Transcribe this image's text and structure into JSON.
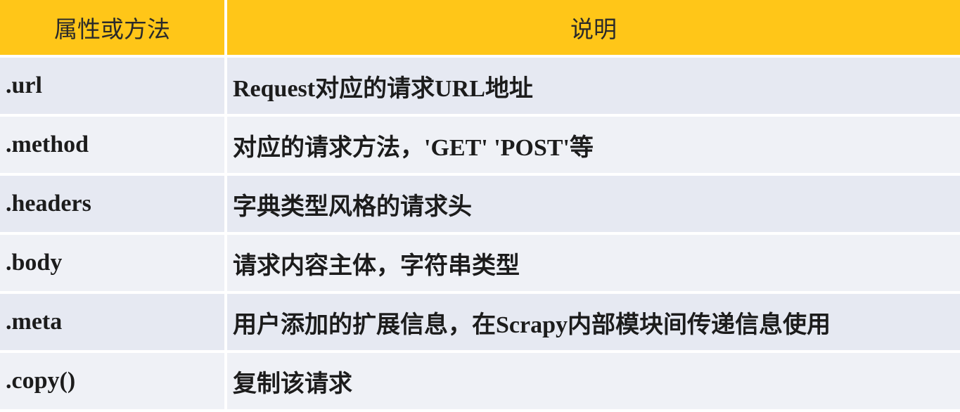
{
  "header": {
    "col1": "属性或方法",
    "col2": "说明"
  },
  "rows": [
    {
      "name": ".url",
      "desc": "Request对应的请求URL地址"
    },
    {
      "name": ".method",
      "desc": "对应的请求方法，'GET' 'POST'等"
    },
    {
      "name": ".headers",
      "desc": "字典类型风格的请求头"
    },
    {
      "name": ".body",
      "desc": "请求内容主体，字符串类型"
    },
    {
      "name": ".meta",
      "desc": "用户添加的扩展信息，在Scrapy内部模块间传递信息使用"
    },
    {
      "name": ".copy()",
      "desc": "复制该请求"
    }
  ],
  "colors": {
    "header_bg": "#ffc618",
    "row_bg_a": "#e6e9f2",
    "row_bg_b": "#eff1f6"
  }
}
